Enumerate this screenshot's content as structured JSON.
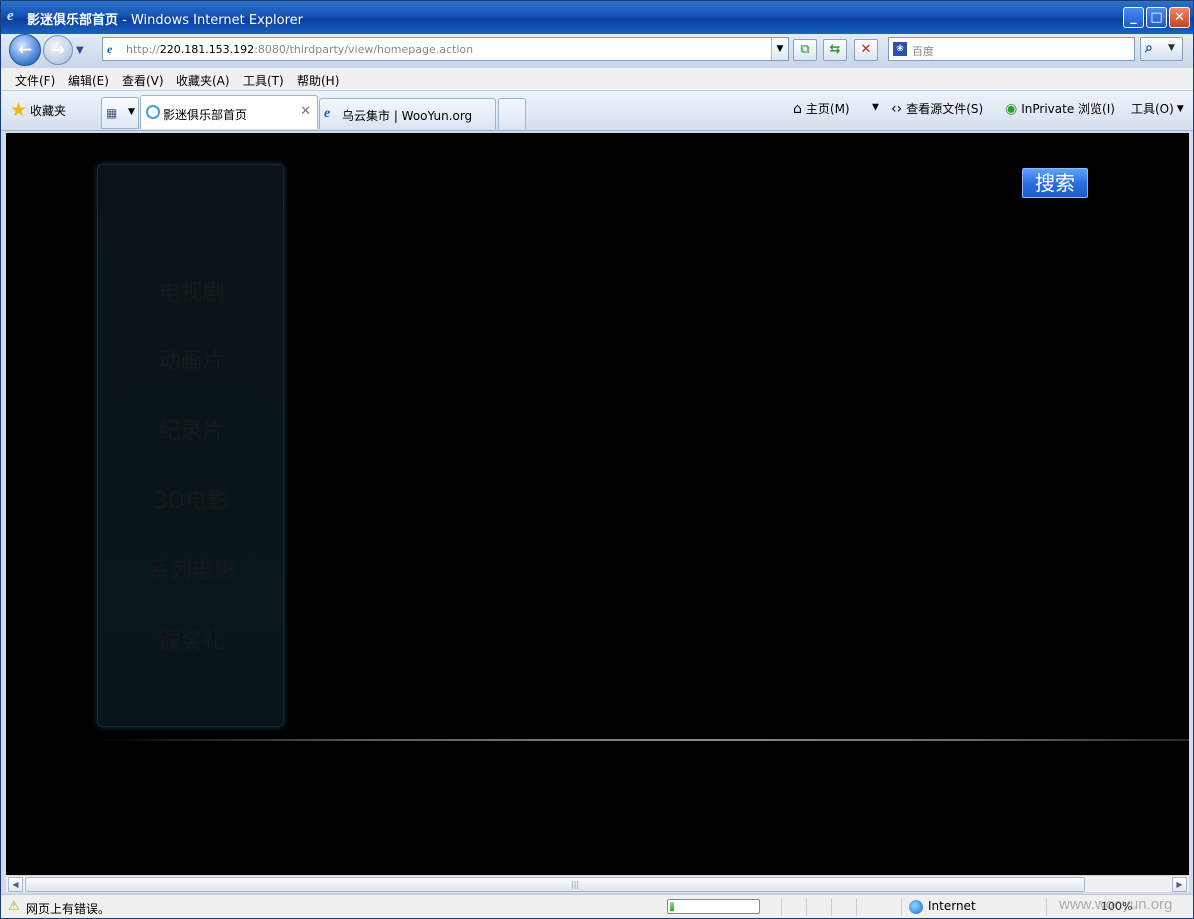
{
  "window": {
    "title_bold": "影迷俱乐部首页",
    "title_rest": " - Windows Internet Explorer",
    "min_glyph": "_",
    "max_glyph": "□",
    "close_glyph": "✕"
  },
  "address_bar": {
    "url_prefix": "http://",
    "url_host": "220.181.153.192",
    "url_rest": ":8080/thirdparty/view/homepage.action"
  },
  "search_box": {
    "placeholder": "百度"
  },
  "menu": {
    "items": [
      "文件(F)",
      "编辑(E)",
      "查看(V)",
      "收藏夹(A)",
      "工具(T)",
      "帮助(H)"
    ]
  },
  "favorites": {
    "label": "收藏夹"
  },
  "tabs": [
    {
      "label": "影迷俱乐部首页",
      "active": true
    },
    {
      "label": "乌云集市 | WooYun.org",
      "active": false
    }
  ],
  "command_bar": {
    "home": "主页(M)",
    "view_source": "查看源文件(S)",
    "inprivate": "InPrivate 浏览(I)",
    "tools": "工具(O)"
  },
  "page": {
    "side_menu": [
      "电视剧",
      "动画片",
      "纪录片",
      "3D电影",
      "系列电影",
      "颁奖礼"
    ],
    "search_button": "搜索"
  },
  "status_bar": {
    "message": "网页上有错误。",
    "zone": "Internet",
    "zoom": "100%",
    "progress": 0.05,
    "watermark": "www.wooyun.org"
  },
  "icons": {
    "ie": "ie-icon",
    "back": "back-arrow-icon",
    "forward": "forward-arrow-icon",
    "refresh": "refresh-icon",
    "stop": "stop-icon",
    "search": "search-icon",
    "star": "star-icon",
    "warning": "warning-icon",
    "globe": "globe-icon"
  }
}
